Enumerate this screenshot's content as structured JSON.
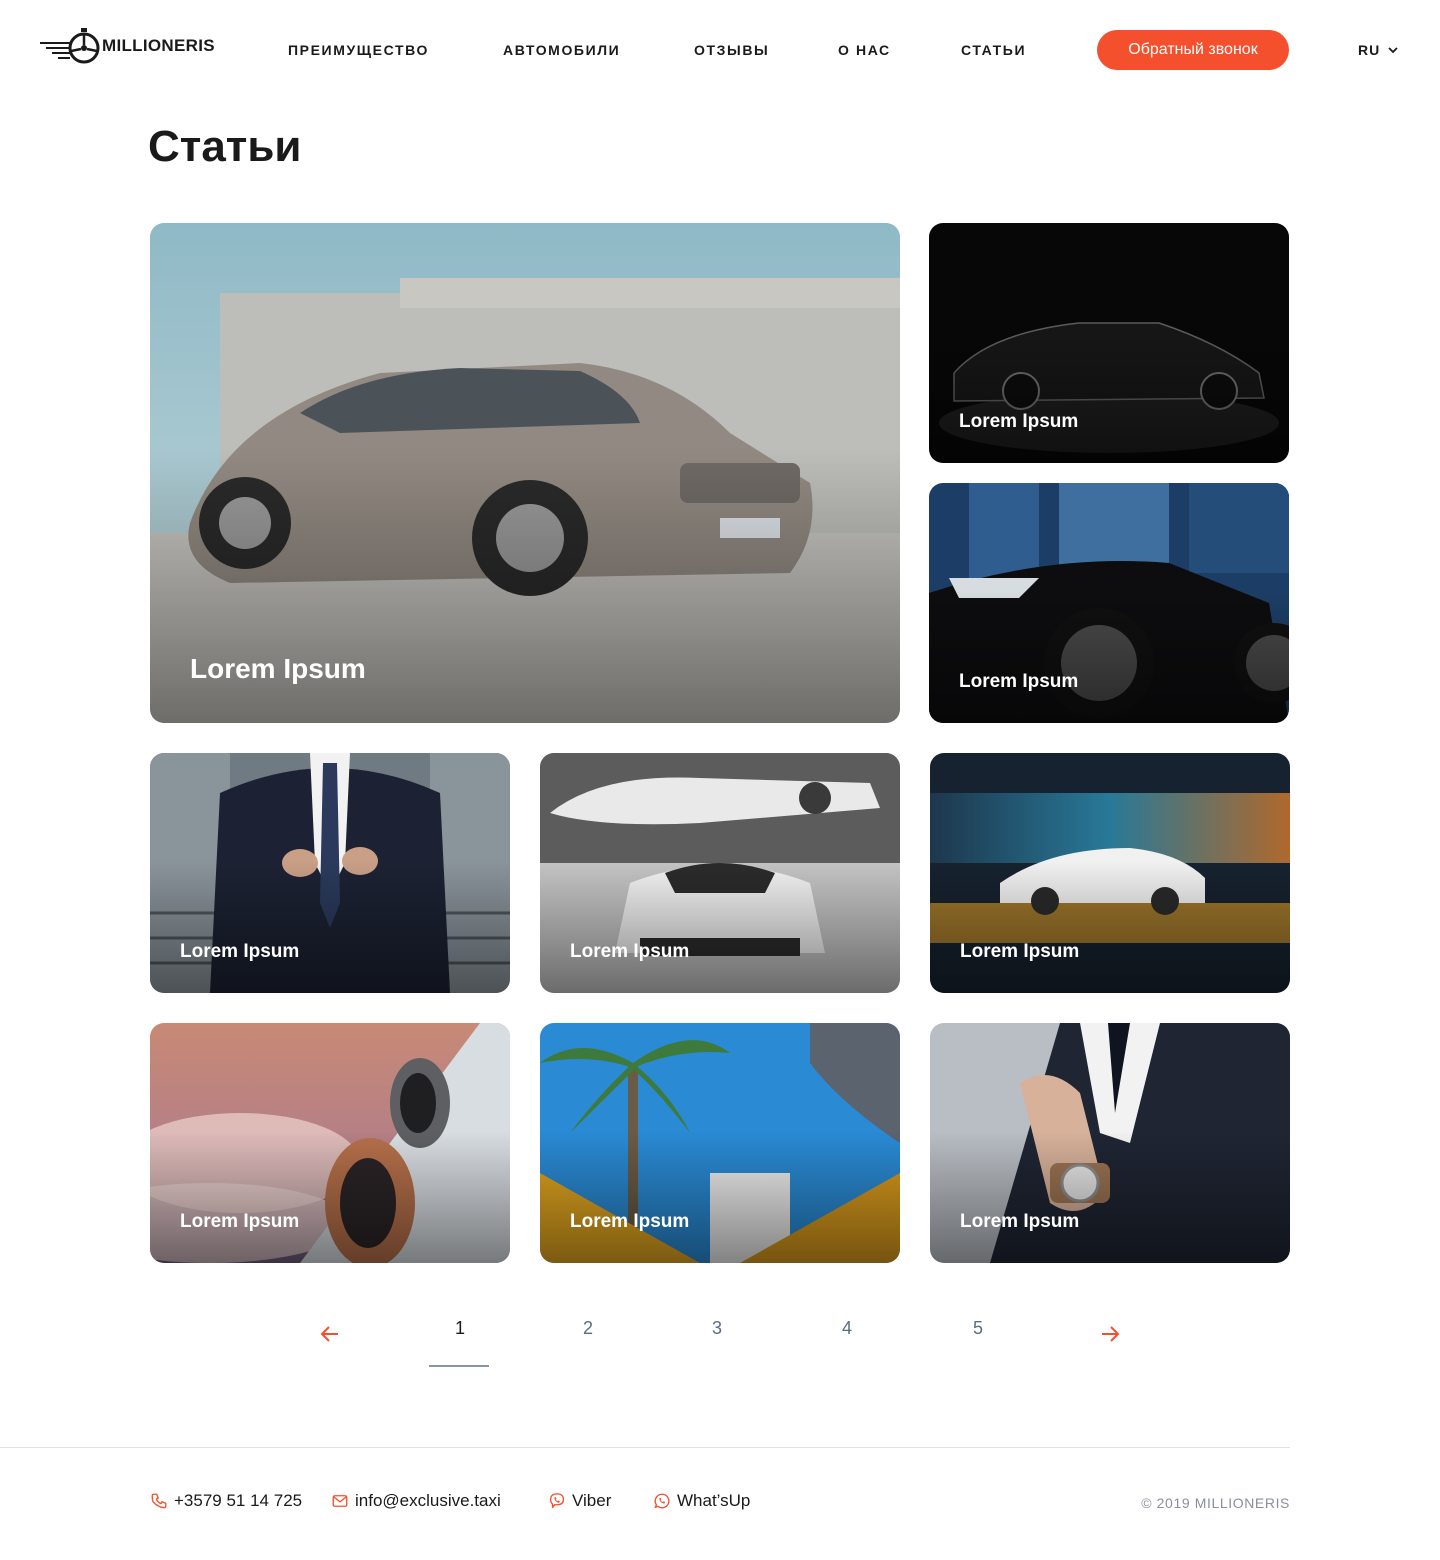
{
  "header": {
    "logo_text": "MILLIONERIS",
    "nav": [
      "ПРЕИМУЩЕСТВО",
      "АВТОМОБИЛИ",
      "ОТЗЫВЫ",
      "О НАС",
      "СТАТЬИ"
    ],
    "cta_label": "Обратный звонок",
    "language": "RU"
  },
  "page": {
    "title": "Статьи"
  },
  "articles": [
    {
      "title": "Lorem Ipsum",
      "image": "silver-mercedes-parking"
    },
    {
      "title": "Lorem Ipsum",
      "image": "black-sedan-dark"
    },
    {
      "title": "Lorem Ipsum",
      "image": "black-sports-car-city"
    },
    {
      "title": "Lorem Ipsum",
      "image": "man-in-suit-stairs"
    },
    {
      "title": "Lorem Ipsum",
      "image": "white-supercar-jet-hangar"
    },
    {
      "title": "Lorem Ipsum",
      "image": "white-car-motion-blur"
    },
    {
      "title": "Lorem Ipsum",
      "image": "airplane-engine-sunset"
    },
    {
      "title": "Lorem Ipsum",
      "image": "palm-tree-yellow-awning"
    },
    {
      "title": "Lorem Ipsum",
      "image": "man-adjusting-tie-watch"
    }
  ],
  "pagination": {
    "pages": [
      "1",
      "2",
      "3",
      "4",
      "5"
    ],
    "current": "1"
  },
  "footer": {
    "phone": "+3579 51 14 725",
    "email": "info@exclusive.taxi",
    "viber": "Viber",
    "whatsapp": "What’sUp",
    "copyright": "© 2019 MILLIONERIS"
  },
  "colors": {
    "accent": "#f4502d",
    "text": "#1a1a1a",
    "muted": "#5a6b85"
  }
}
